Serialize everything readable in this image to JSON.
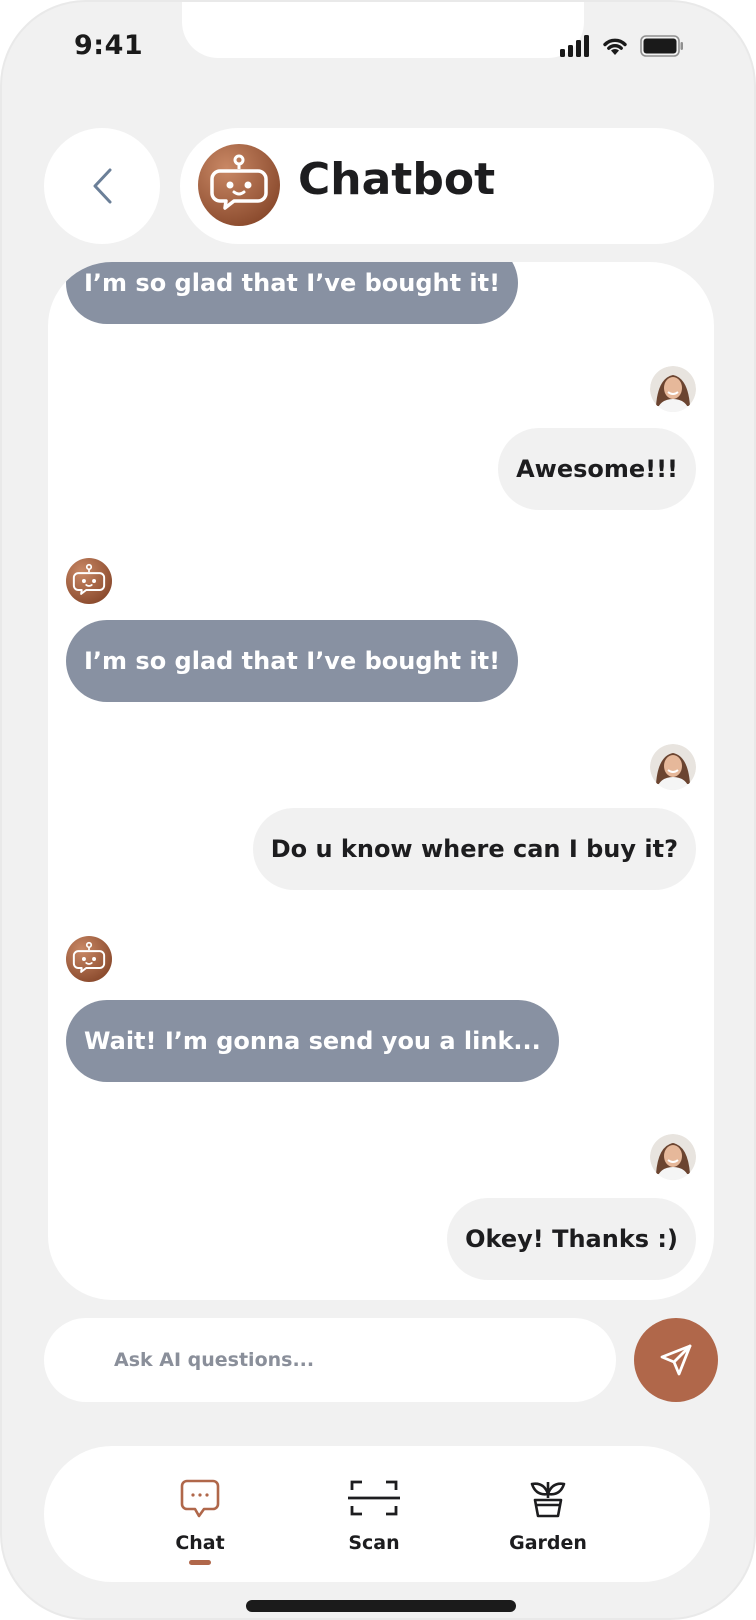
{
  "status_bar": {
    "time": "9:41"
  },
  "header": {
    "title": "Chatbot"
  },
  "messages": [
    {
      "sender": "bot",
      "text": "I’m so glad that I’ve bought it!"
    },
    {
      "sender": "user",
      "text": "Awesome!!!"
    },
    {
      "sender": "bot",
      "text": "I’m so glad that I’ve bought it!"
    },
    {
      "sender": "user",
      "text": "Do u know where can I buy it?"
    },
    {
      "sender": "bot",
      "text": "Wait! I’m gonna send you a link..."
    },
    {
      "sender": "user",
      "text": "Okey! Thanks :)"
    }
  ],
  "composer": {
    "placeholder": "Ask AI questions...",
    "value": ""
  },
  "tabs": [
    {
      "label": "Chat",
      "icon": "chat-bubble-icon",
      "active": true
    },
    {
      "label": "Scan",
      "icon": "scan-frame-icon",
      "active": false
    },
    {
      "label": "Garden",
      "icon": "plant-pot-icon",
      "active": false
    }
  ],
  "colors": {
    "accent": "#b0674a",
    "bot_bubble": "#8891a2",
    "user_bubble": "#f1f1f1",
    "background": "#f1f1f1",
    "card": "#ffffff"
  }
}
